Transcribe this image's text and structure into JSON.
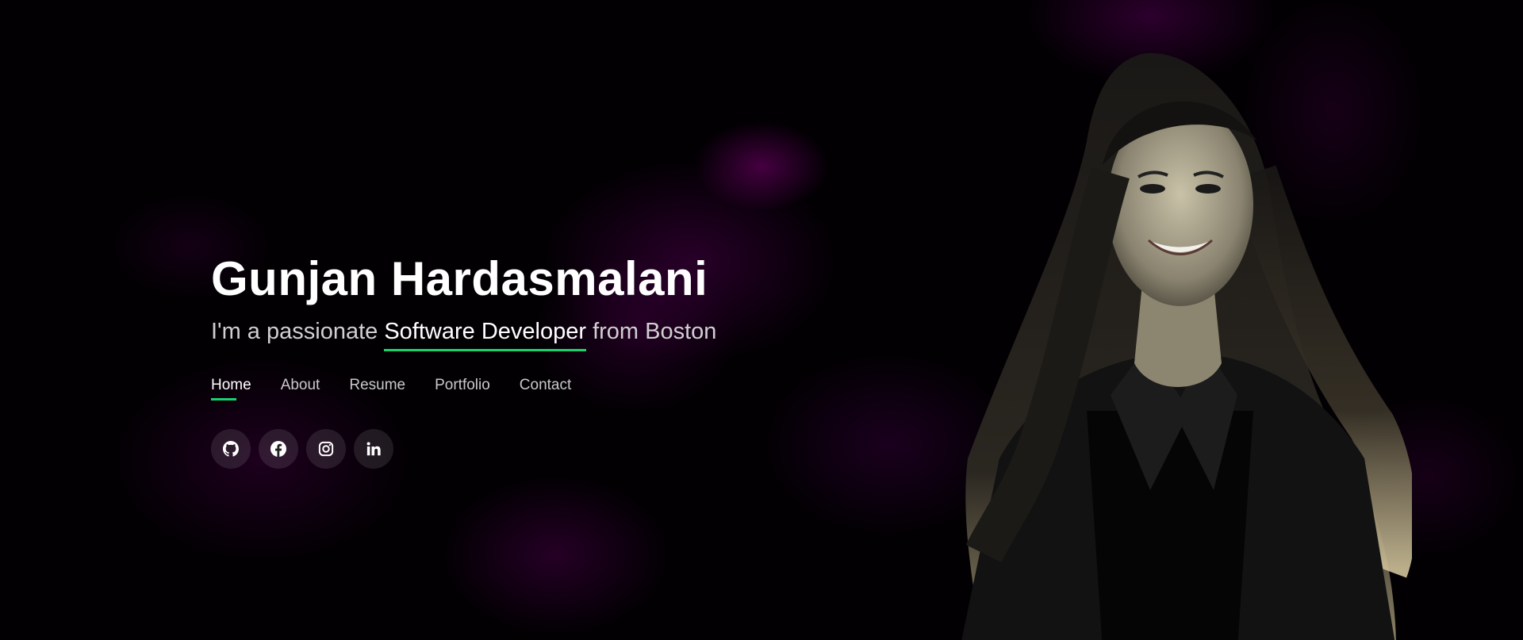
{
  "hero": {
    "name": "Gunjan Hardasmalani",
    "tagline_prefix": "I'm a passionate ",
    "tagline_typed": "Software Developer",
    "tagline_suffix": " from Boston"
  },
  "nav": {
    "items": [
      {
        "label": "Home",
        "active": true
      },
      {
        "label": "About"
      },
      {
        "label": "Resume"
      },
      {
        "label": "Portfolio"
      },
      {
        "label": "Contact"
      }
    ]
  },
  "social": {
    "icons": [
      "github-icon",
      "facebook-icon",
      "instagram-icon",
      "linkedin-icon"
    ]
  },
  "colors": {
    "accent": "#18d26e",
    "background": "#000000",
    "glow": "#7a0070"
  }
}
